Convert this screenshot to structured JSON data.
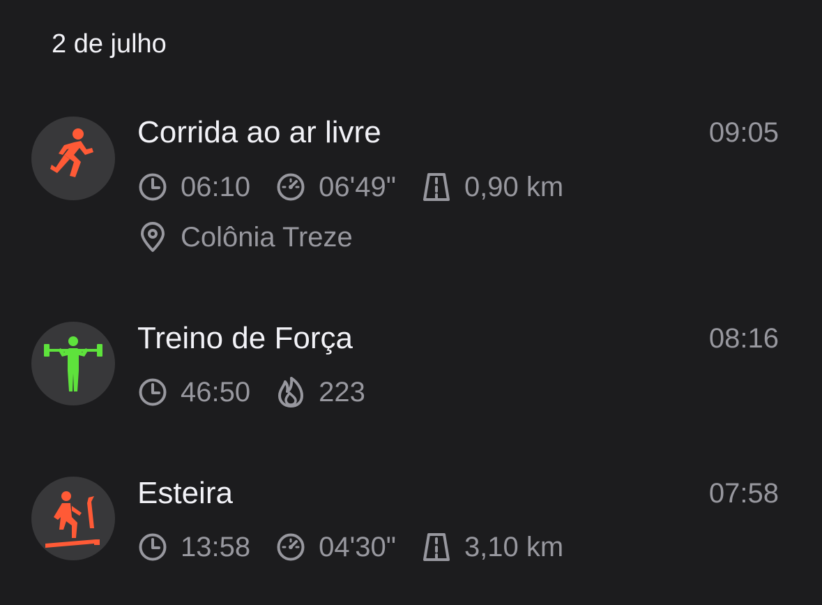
{
  "date_header": "2 de julho",
  "colors": {
    "background": "#1c1c1e",
    "avatar_bg": "#38383a",
    "run_accent": "#ff5a36",
    "strength_accent": "#5ee33c",
    "treadmill_accent": "#ff5a36",
    "secondary_text": "#98989f"
  },
  "workouts": [
    {
      "title": "Corrida ao ar livre",
      "time": "09:05",
      "icon": "running-person-icon",
      "duration": "06:10",
      "pace": "06'49\"",
      "distance": "0,90 km",
      "location": "Colônia Treze"
    },
    {
      "title": "Treino de Força",
      "time": "08:16",
      "icon": "weightlifting-icon",
      "duration": "46:50",
      "calories": "223"
    },
    {
      "title": "Esteira",
      "time": "07:58",
      "icon": "treadmill-icon",
      "duration": "13:58",
      "pace": "04'30\"",
      "distance": "3,10 km"
    }
  ]
}
